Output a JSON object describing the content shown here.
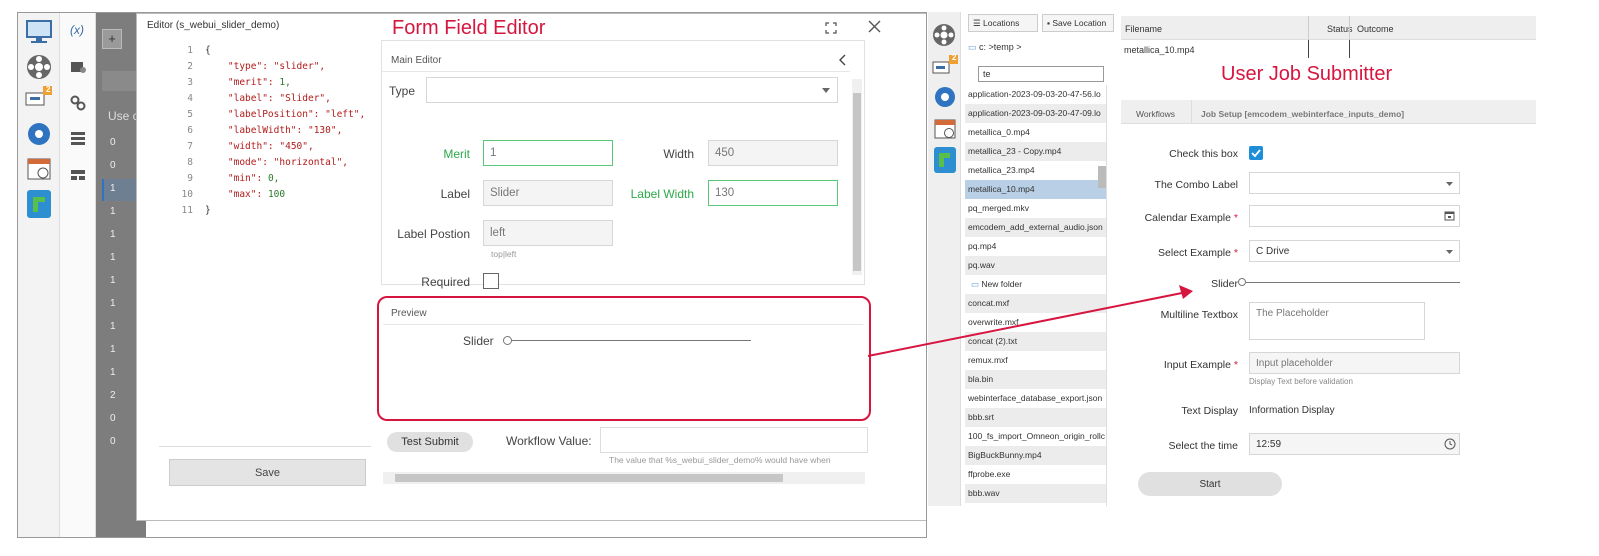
{
  "left": {
    "editor_title": "Editor (s_webui_slider_demo)",
    "variable_icon_label": "(x)",
    "bg_plus": "+",
    "bg_use_text": "Use c",
    "bg_numbers": [
      "0",
      "0",
      "1",
      "1",
      "1",
      "1",
      "1",
      "1",
      "1",
      "1",
      "1",
      "2",
      "0",
      "0"
    ],
    "badge_count": "2",
    "code_lines": [
      {
        "n": "1",
        "k": "{",
        "v": ""
      },
      {
        "n": "2",
        "k": "\"type\":",
        "v": "\"slider\","
      },
      {
        "n": "3",
        "k": "\"merit\":",
        "v": "1,"
      },
      {
        "n": "4",
        "k": "\"label\":",
        "v": "\"Slider\","
      },
      {
        "n": "5",
        "k": "\"labelPosition\":",
        "v": "\"left\","
      },
      {
        "n": "6",
        "k": "\"labelWidth\":",
        "v": "\"130\","
      },
      {
        "n": "7",
        "k": "\"width\":",
        "v": "\"450\","
      },
      {
        "n": "8",
        "k": "\"mode\":",
        "v": "\"horizontal\","
      },
      {
        "n": "9",
        "k": "\"min\":",
        "v": "0,"
      },
      {
        "n": "10",
        "k": "\"max\":",
        "v": "100"
      },
      {
        "n": "11",
        "k": "}",
        "v": ""
      }
    ],
    "save_label": "Save",
    "annotation_title": "Form Field Editor",
    "main_editor": {
      "title": "Main Editor",
      "type_label": "Type",
      "merit_label": "Merit",
      "merit_value": "1",
      "width_label": "Width",
      "width_value": "450",
      "label_label": "Label",
      "label_value": "Slider",
      "label_width_label": "Label Width",
      "label_width_value": "130",
      "label_position_label": "Label Postion",
      "label_position_value": "left",
      "label_position_hint": "top|left",
      "required_label": "Required"
    },
    "preview": {
      "title": "Preview",
      "slider_label": "Slider"
    },
    "test_submit_label": "Test Submit",
    "workflow_value_label": "Workflow Value:",
    "workflow_hint": "The value that %s_webui_slider_demo% would have when"
  },
  "right": {
    "locations_label": "Locations",
    "save_location_label": "Save Location",
    "path": "c: >temp >",
    "filter_value": "te",
    "badge_count": "2",
    "files": [
      "application-2023-09-03-20-47-56.lo",
      "application-2023-09-03-20-47-09.lo",
      "metallica_0.mp4",
      "metallica_23 - Copy.mp4",
      "metallica_23.mp4",
      "metallica_10.mp4",
      "pq_merged.mkv",
      "emcodem_add_external_audio.json",
      "pq.mp4",
      "pq.wav",
      "New folder",
      "concat.mxf",
      "overwrite.mxf",
      "concat (2).txt",
      "remux.mxf",
      "bla.bin",
      "webinterface_database_export.json",
      "bbb.srt",
      "100_fs_import_Omneon_origin_rollc",
      "BigBuckBunny.mp4",
      "ffprobe.exe",
      "bbb.wav"
    ],
    "table_headers": {
      "filename": "Filename",
      "status": "Status",
      "outcome": "Outcome"
    },
    "table_row": {
      "filename": "metallica_10.mp4"
    },
    "annotation_title": "User Job Submitter",
    "tabs": [
      "Workflows",
      "Job Setup [emcodem_webinterface_inputs_demo]"
    ],
    "form": {
      "check_label": "Check this box",
      "combo_label": "The Combo Label",
      "calendar_label": "Calendar Example",
      "select_label": "Select Example",
      "select_value": "C Drive",
      "slider_label": "Slider",
      "multiline_label": "Multiline Textbox",
      "multiline_placeholder": "The Placeholder",
      "input_label": "Input Example",
      "input_placeholder": "Input placeholder",
      "input_hint": "Display Text before validation",
      "text_display_label": "Text Display",
      "text_display_value": "Information Display",
      "time_label": "Select the time",
      "time_value": "12:59",
      "required_mark": "*",
      "start_label": "Start"
    }
  },
  "colors": {
    "annotation": "#d6163f",
    "valid_green": "#2da84a",
    "checkbox_blue": "#1e8fd6",
    "selection": "#b9cfe6"
  }
}
